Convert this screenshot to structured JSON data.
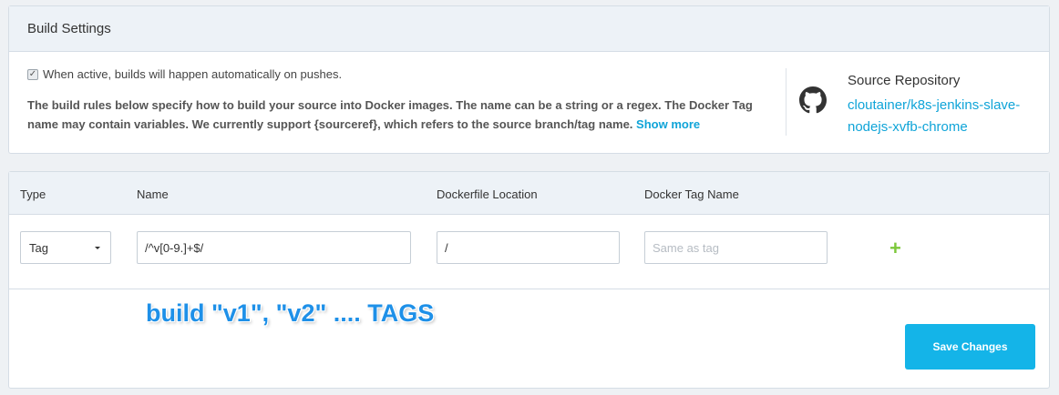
{
  "build_settings": {
    "title": "Build Settings",
    "autobuild_checked": true,
    "autobuild_label": "When active, builds will happen automatically on pushes.",
    "description": "The build rules below specify how to build your source into Docker images. The name can be a string or a regex. The Docker Tag name may contain variables. We currently support {sourceref}, which refers to the source branch/tag name.",
    "show_more": "Show more"
  },
  "source_repository": {
    "title": "Source Repository",
    "icon": "github-icon",
    "link_text": "cloutainer/k8s-jenkins-slave-nodejs-xvfb-chrome"
  },
  "rules_table": {
    "columns": {
      "type": "Type",
      "name": "Name",
      "dockerfile_location": "Dockerfile Location",
      "docker_tag_name": "Docker Tag Name"
    },
    "rows": [
      {
        "type": "Tag",
        "name": "/^v[0-9.]+$/",
        "dockerfile_location": "/",
        "docker_tag_name": "",
        "docker_tag_placeholder": "Same as tag"
      }
    ],
    "add_icon": "plus-icon"
  },
  "annotation": "build \"v1\", \"v2\" .... TAGS",
  "save_button": "Save Changes",
  "colors": {
    "accent": "#14b4e8",
    "link": "#0fa4d8",
    "add": "#7cc83a",
    "annotation": "#1e90e8"
  }
}
